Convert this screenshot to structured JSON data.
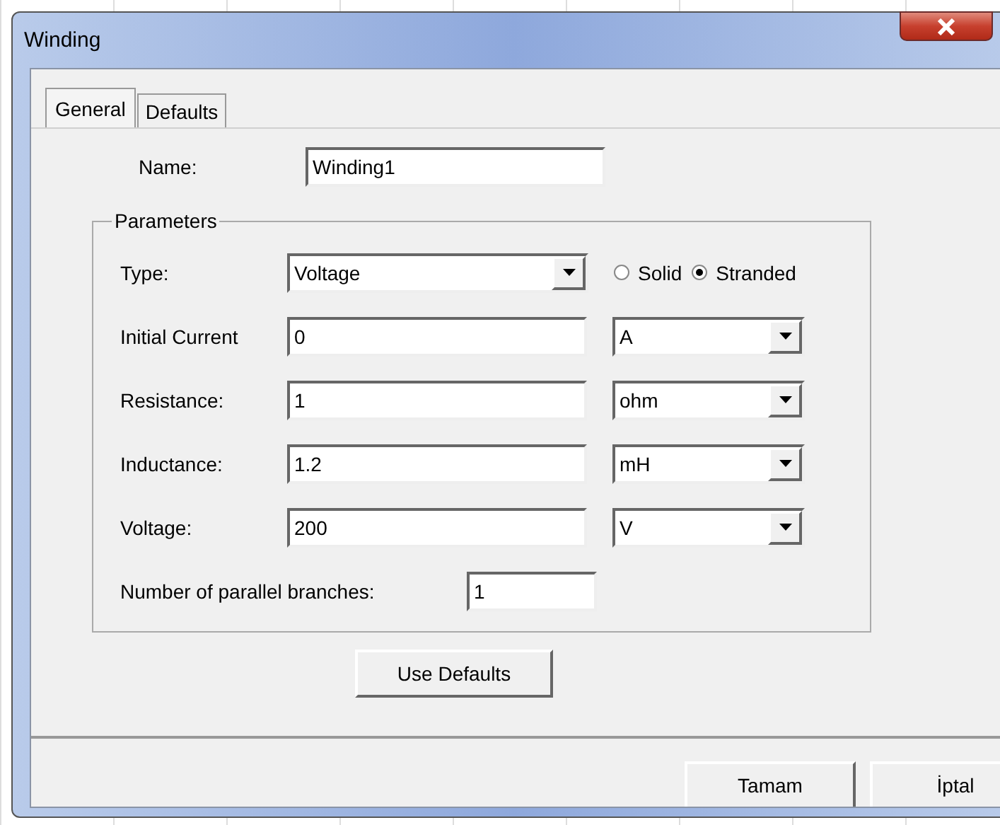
{
  "window": {
    "title": "Winding"
  },
  "tabs": [
    {
      "label": "General",
      "selected": true
    },
    {
      "label": "Defaults",
      "selected": false
    }
  ],
  "name": {
    "label": "Name:",
    "value": "Winding1"
  },
  "parameters": {
    "title": "Parameters",
    "type": {
      "label": "Type:",
      "value": "Voltage",
      "options": [
        {
          "label": "Solid",
          "selected": false
        },
        {
          "label": "Stranded",
          "selected": true
        }
      ]
    },
    "rows": [
      {
        "label": "Initial Current",
        "value": "0",
        "unit": "A"
      },
      {
        "label": "Resistance:",
        "value": "1",
        "unit": "ohm"
      },
      {
        "label": "Inductance:",
        "value": "1.2",
        "unit": "mH"
      },
      {
        "label": "Voltage:",
        "value": "200",
        "unit": "V"
      }
    ],
    "branches": {
      "label": "Number of parallel branches:",
      "value": "1"
    }
  },
  "use_defaults_button": "Use Defaults",
  "buttons": [
    "Tamam",
    "İptal"
  ]
}
